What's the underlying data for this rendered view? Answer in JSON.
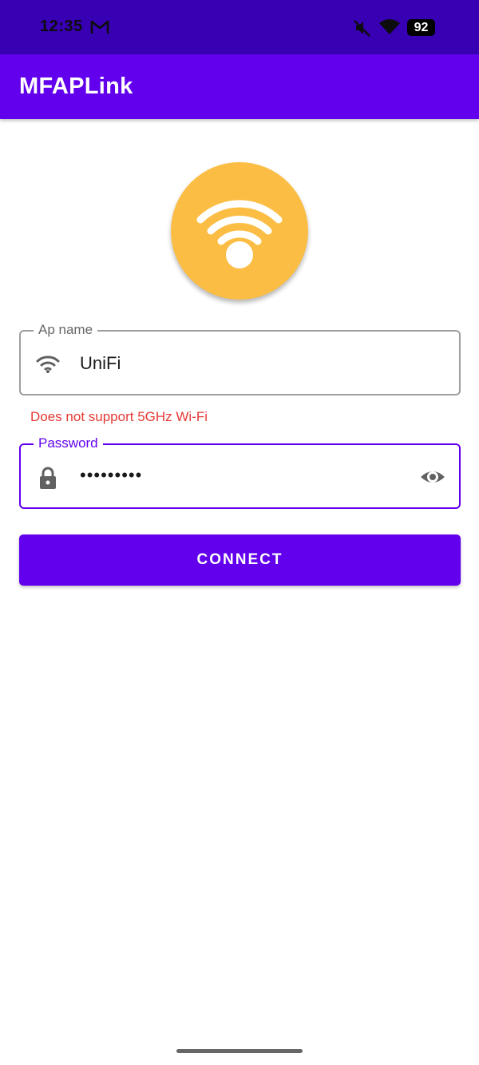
{
  "status_bar": {
    "time": "12:35",
    "battery": "92",
    "icons": [
      "gmail-icon",
      "mute-icon",
      "wifi-icon",
      "battery-icon"
    ]
  },
  "app_bar": {
    "title": "MFAPLink"
  },
  "logo": {
    "icon": "wifi-icon",
    "color": "#fbbd43"
  },
  "form": {
    "ap_name": {
      "label": "Ap name",
      "value": "UniFi",
      "icon": "wifi-icon"
    },
    "ap_error": "Does not support 5GHz Wi-Fi",
    "password": {
      "label": "Password",
      "value": "•••••••••",
      "icon": "lock-icon",
      "toggle_icon": "eye-icon"
    },
    "connect_label": "CONNECT"
  },
  "colors": {
    "primary": "#6200ee",
    "primary_dark": "#3700b3",
    "error": "#e53935",
    "accent": "#fbbd43"
  }
}
